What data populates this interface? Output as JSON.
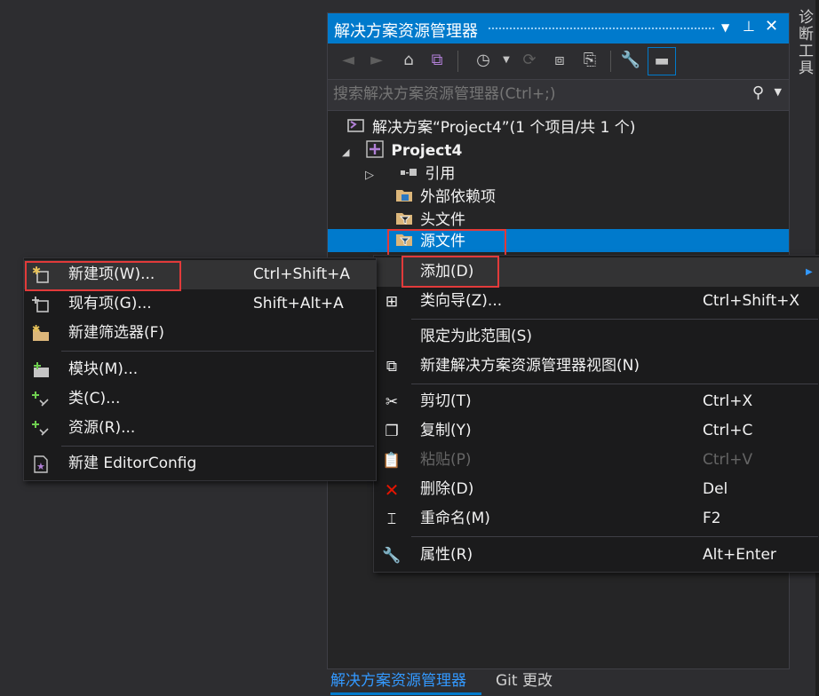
{
  "solution_explorer": {
    "title": "解决方案资源管理器",
    "search_placeholder": "搜索解决方案资源管理器(Ctrl+;)",
    "tree": {
      "solution": "解决方案“Project4”(1 个项目/共 1 个)",
      "project": "Project4",
      "references": "引用",
      "external_deps": "外部依赖项",
      "header_files": "头文件",
      "source_files": "源文件"
    }
  },
  "side_tab": "诊断工具",
  "bottom_tabs": {
    "solution_explorer": "解决方案资源管理器",
    "git": "Git 更改"
  },
  "context_menu": {
    "add": "添加(D)",
    "class_wizard": {
      "label": "类向导(Z)...",
      "shortcut": "Ctrl+Shift+X"
    },
    "scope": "限定为此范围(S)",
    "new_view": "新建解决方案资源管理器视图(N)",
    "cut": {
      "label": "剪切(T)",
      "shortcut": "Ctrl+X"
    },
    "copy": {
      "label": "复制(Y)",
      "shortcut": "Ctrl+C"
    },
    "paste": {
      "label": "粘贴(P)",
      "shortcut": "Ctrl+V"
    },
    "delete": {
      "label": "删除(D)",
      "shortcut": "Del"
    },
    "rename": {
      "label": "重命名(M)",
      "shortcut": "F2"
    },
    "properties": {
      "label": "属性(R)",
      "shortcut": "Alt+Enter"
    }
  },
  "add_submenu": {
    "new_item": {
      "label": "新建项(W)...",
      "shortcut": "Ctrl+Shift+A"
    },
    "existing_item": {
      "label": "现有项(G)...",
      "shortcut": "Shift+Alt+A"
    },
    "new_filter": "新建筛选器(F)",
    "module": "模块(M)...",
    "class": "类(C)...",
    "resource": "资源(R)...",
    "editorconfig": "新建 EditorConfig"
  },
  "colors": {
    "accent": "#007acc",
    "highlight_box": "#e23a3a",
    "menu_bg": "#1b1b1c"
  }
}
